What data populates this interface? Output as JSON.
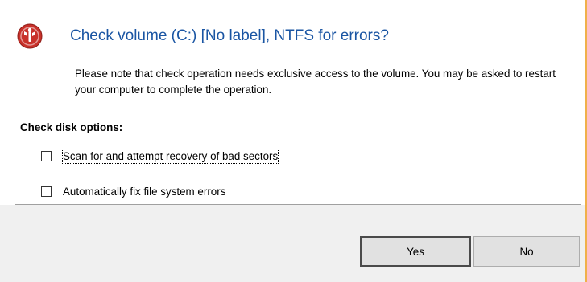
{
  "dialog": {
    "title": "Check volume (C:) [No label], NTFS for errors?",
    "note": "Please note that check operation needs exclusive access to the volume. You may be asked to restart your computer to complete the operation.",
    "options_heading": "Check disk options:",
    "options": [
      {
        "label": "Scan for and attempt recovery of bad sectors",
        "checked": false
      },
      {
        "label": "Automatically fix file system errors",
        "checked": false
      }
    ],
    "buttons": {
      "yes": "Yes",
      "no": "No"
    }
  },
  "colors": {
    "title": "#1a55a3",
    "icon": "#c8312a",
    "accent_border": "#f0b04a"
  }
}
